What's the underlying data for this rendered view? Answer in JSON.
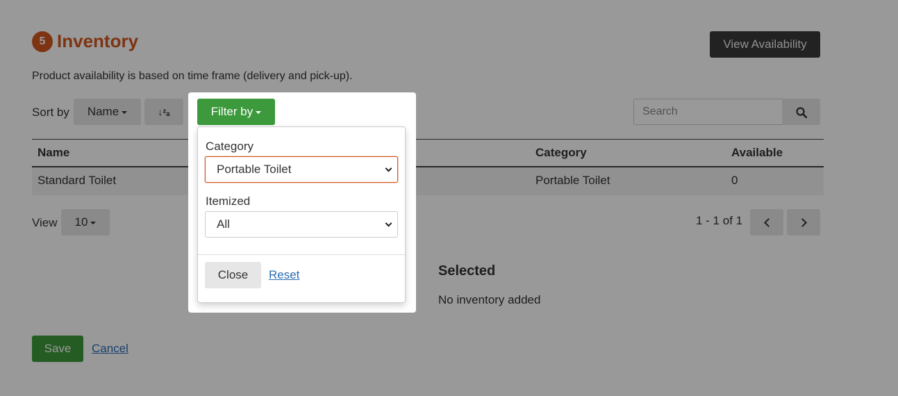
{
  "header": {
    "step_number": "5",
    "title": "Inventory",
    "view_availability_label": "View Availability",
    "subtitle": "Product availability is based on time frame (delivery and pick-up)."
  },
  "sort": {
    "label": "Sort by",
    "selected": "Name",
    "order_icon": "sort-alpha-icon"
  },
  "search": {
    "placeholder": "Search",
    "icon": "search-icon"
  },
  "table": {
    "columns": [
      "Name",
      "Category",
      "Available"
    ],
    "rows": [
      {
        "name": "Standard Toilet",
        "category": "Portable Toilet",
        "available": "0"
      }
    ]
  },
  "pagination": {
    "view_label": "View",
    "per_page": "10",
    "info": "1 - 1 of 1"
  },
  "selected": {
    "title": "Selected",
    "empty_text": "No inventory added"
  },
  "footer": {
    "save_label": "Save",
    "cancel_label": "Cancel"
  },
  "filter": {
    "button_label": "Filter by",
    "category_label": "Category",
    "category_value": "Portable Toilet",
    "itemized_label": "Itemized",
    "itemized_value": "All",
    "close_label": "Close",
    "reset_label": "Reset"
  },
  "colors": {
    "accent": "#d3561e",
    "primary_green": "#3c9a3c",
    "link": "#2a6db5",
    "overlay": "rgba(0,0,0,0.4)"
  }
}
